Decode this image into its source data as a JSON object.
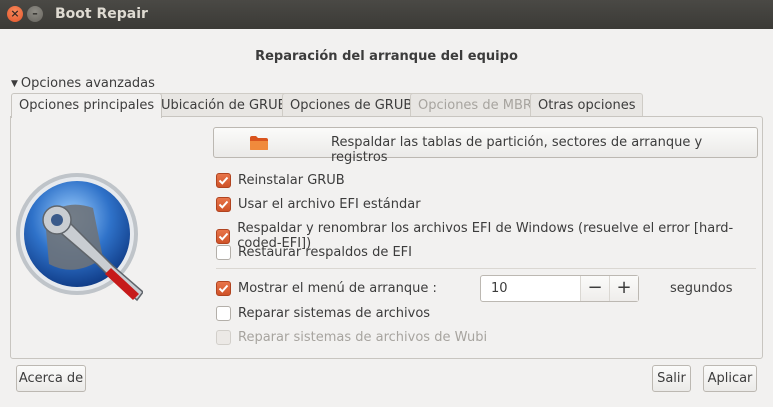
{
  "window": {
    "title": "Boot Repair",
    "close_glyph": "×",
    "minimize_glyph": "–"
  },
  "heading": "Reparación del arranque del equipo",
  "expander": {
    "label": "Opciones avanzadas",
    "icon": "triangle-down-icon"
  },
  "tabs": [
    {
      "label": "Opciones principales",
      "state": "active"
    },
    {
      "label": "Ubicación de GRUB",
      "state": "normal"
    },
    {
      "label": "Opciones de GRUB",
      "state": "normal"
    },
    {
      "label": "Opciones de MBR",
      "state": "disabled"
    },
    {
      "label": "Otras opciones",
      "state": "normal"
    }
  ],
  "backup_button": {
    "label": "Respaldar las tablas de partición, sectores de arranque y registros",
    "icon": "folder-icon"
  },
  "options": [
    {
      "label": "Reinstalar GRUB",
      "checked": true,
      "enabled": true
    },
    {
      "label": "Usar el archivo EFI estándar",
      "checked": true,
      "enabled": true
    },
    {
      "label": "Respaldar y renombrar los archivos EFI de Windows (resuelve el error [hard-coded-EFI])",
      "checked": true,
      "enabled": true
    },
    {
      "label": "Restaurar respaldos de EFI",
      "checked": false,
      "enabled": true
    }
  ],
  "boot_menu": {
    "label": "Mostrar el menú de arranque :",
    "checked": true,
    "value": "10",
    "unit": "segundos",
    "minus": "−",
    "plus": "+"
  },
  "extra_options": [
    {
      "label": "Reparar sistemas de archivos",
      "checked": false,
      "enabled": true
    },
    {
      "label": "Reparar sistemas de archivos de Wubi",
      "checked": false,
      "enabled": false
    }
  ],
  "footer": {
    "about": "Acerca de",
    "quit": "Salir",
    "apply": "Aplicar"
  },
  "colors": {
    "accent": "#e0632f",
    "titlebar": "#3c3b37",
    "background": "#f2f1f0"
  }
}
